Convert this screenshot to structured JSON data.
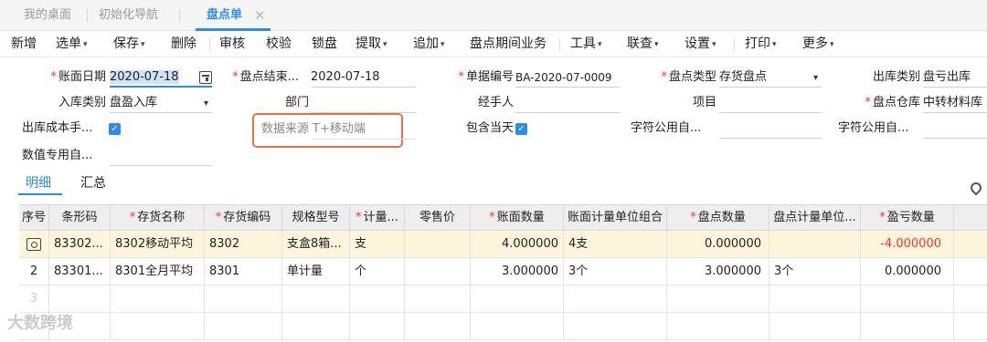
{
  "tabs": [
    {
      "label": "我的桌面"
    },
    {
      "label": "初始化导航"
    },
    {
      "label": "盘点单"
    }
  ],
  "tab_close": "✕",
  "toolbar": [
    {
      "label": "新增"
    },
    {
      "label": "选单"
    },
    {
      "label": "保存"
    },
    {
      "label": "删除"
    },
    {
      "label": "审核"
    },
    {
      "label": "校验"
    },
    {
      "label": "锁盘"
    },
    {
      "label": "提取"
    },
    {
      "label": "追加"
    },
    {
      "label": "盘点期间业务"
    },
    {
      "label": "工具"
    },
    {
      "label": "联查"
    },
    {
      "label": "设置"
    },
    {
      "label": "打印"
    },
    {
      "label": "更多"
    }
  ],
  "dropdown_caret": "▾",
  "form": {
    "ledger_date_label": "账面日期",
    "ledger_date_value": "2020-07-18",
    "count_end_label": "盘点结束...",
    "count_end_value": "2020-07-18",
    "doc_no_label": "单据编号",
    "doc_no_value": "BA-2020-07-0009",
    "count_type_label": "盘点类型",
    "count_type_value": "存货盘点",
    "out_type_label": "出库类别",
    "out_type_value": "盘亏出库",
    "in_type_label": "入库类别",
    "in_type_value": "盘盈入库",
    "dept_label": "部门",
    "dept_value": "",
    "handler_label": "经手人",
    "handler_value": "",
    "project_label": "项目",
    "project_value": "",
    "warehouse_label": "盘点仓库",
    "warehouse_value": "中转材料库",
    "out_cost_label": "出库成本手...",
    "out_cost_checked": true,
    "data_source_label": "数据来源",
    "data_source_value": "T+移动端",
    "include_today_label": "包含当天",
    "include_today_checked": true,
    "char_public1_label": "字符公用自...",
    "char_public1_value": "",
    "char_public2_label": "字符公用自...",
    "char_public2_value": "",
    "num_custom_label": "数值专用自...",
    "num_custom_value": ""
  },
  "check_mark": "✓",
  "detail_tabs": [
    {
      "label": "明细"
    },
    {
      "label": "汇总"
    }
  ],
  "table": {
    "headers": [
      {
        "label": "序号",
        "required": false
      },
      {
        "label": "条形码",
        "required": false
      },
      {
        "label": "存货名称",
        "required": true
      },
      {
        "label": "存货编码",
        "required": true
      },
      {
        "label": "规格型号",
        "required": false
      },
      {
        "label": "计量...",
        "required": true
      },
      {
        "label": "零售价",
        "required": false
      },
      {
        "label": "账面数量",
        "required": true
      },
      {
        "label": "账面计量单位组合",
        "required": false
      },
      {
        "label": "盘点数量",
        "required": true
      },
      {
        "label": "盘点计量单位...",
        "required": false
      },
      {
        "label": "盈亏数量",
        "required": true
      }
    ],
    "required_mark": "*",
    "rows": [
      {
        "seq": "",
        "barcode": "83302...",
        "name": "8302移动平均",
        "code": "8302",
        "spec": "支盒8箱...",
        "unit": "支",
        "price": "",
        "book_qty": "4.000000",
        "book_unit": "4支",
        "count_qty": "0.000000",
        "count_unit": "",
        "diff_qty": "-4.000000"
      },
      {
        "seq": "2",
        "barcode": "83301...",
        "name": "8301全月平均",
        "code": "8301",
        "spec": "单计量",
        "unit": "个",
        "price": "",
        "book_qty": "3.000000",
        "book_unit": "3个",
        "count_qty": "3.000000",
        "count_unit": "3个",
        "diff_qty": "0.000000"
      },
      {
        "seq": "3",
        "barcode": "",
        "name": "",
        "code": "",
        "spec": "",
        "unit": "",
        "price": "",
        "book_qty": "",
        "book_unit": "",
        "count_qty": "",
        "count_unit": "",
        "diff_qty": ""
      }
    ]
  },
  "watermark_text": "大数跨境",
  "colors": {
    "accent": "#2d8ce8",
    "required": "#e33333",
    "highlight_box": "#e8704a",
    "selected_row": "#fdf6dc"
  }
}
